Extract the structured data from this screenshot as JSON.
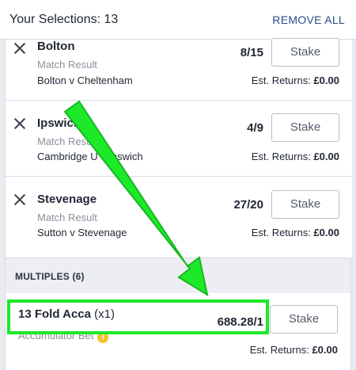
{
  "header": {
    "title": "Your Selections: 13",
    "remove_all": "REMOVE ALL"
  },
  "selections": [
    {
      "name": "Bolton",
      "market": "Match Result",
      "event": "Bolton v Cheltenham",
      "odds": "8/15",
      "stake_placeholder": "Stake",
      "returns_label": "Est. Returns:",
      "returns_value": "£0.00"
    },
    {
      "name": "Ipswich",
      "market": "Match Result",
      "event": "Cambridge U v Ipswich",
      "odds": "4/9",
      "stake_placeholder": "Stake",
      "returns_label": "Est. Returns:",
      "returns_value": "£0.00"
    },
    {
      "name": "Stevenage",
      "market": "Match Result",
      "event": "Sutton v Stevenage",
      "odds": "27/20",
      "stake_placeholder": "Stake",
      "returns_label": "Est. Returns:",
      "returns_value": "£0.00"
    }
  ],
  "multiples": {
    "header": "MULTIPLES (6)",
    "items": [
      {
        "name": "13 Fold Acca",
        "multiplier": "(x1)",
        "type": "Accumulator Bet",
        "info_icon": "info-icon",
        "odds": "688.28/1",
        "stake_placeholder": "Stake",
        "returns_label": "Est. Returns:",
        "returns_value": "£0.00"
      }
    ]
  },
  "annotation": {
    "arrow_color": "#1ee82a",
    "highlight_color": "#1ee82a"
  },
  "colors": {
    "link": "#2a4a86",
    "muted": "#8a909b",
    "background": "#e9ebf0"
  }
}
